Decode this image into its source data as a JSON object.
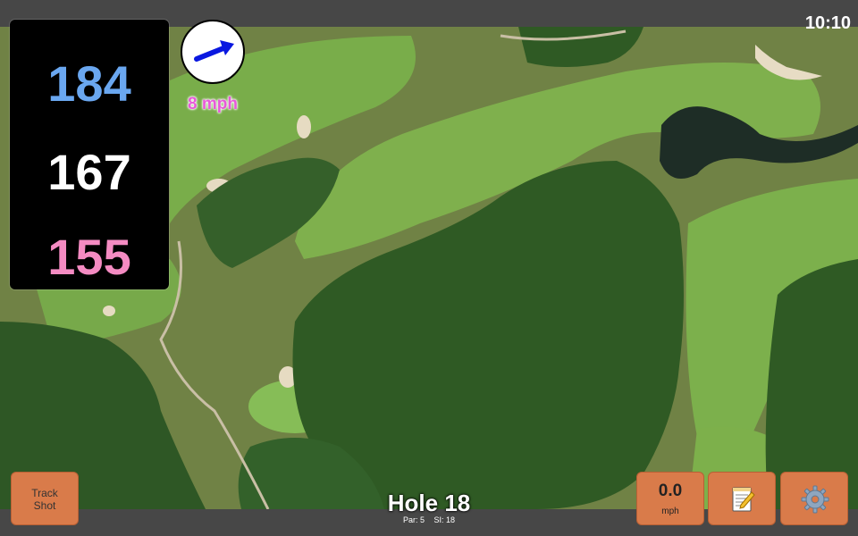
{
  "status_bar": {
    "clock": "10:10"
  },
  "distances": {
    "back": "184",
    "middle": "167",
    "front": "155"
  },
  "wind": {
    "speed": "8 mph",
    "direction_icon": "arrow-icon"
  },
  "track_shot": {
    "label_line1": "Track",
    "label_line2": "Shot"
  },
  "speed_button": {
    "value": "0.0",
    "unit": "mph"
  },
  "hole": {
    "title": "Hole 18",
    "par": "Par: 5",
    "si": "SI: 18"
  },
  "toolbar": {
    "notes_icon": "notepad-icon",
    "settings_icon": "gear-icon"
  },
  "colors": {
    "back": "#6aa7f0",
    "middle": "#ffffff",
    "front": "#f48bc2",
    "wind": "#e85ad9",
    "button": "#d97b4a"
  }
}
